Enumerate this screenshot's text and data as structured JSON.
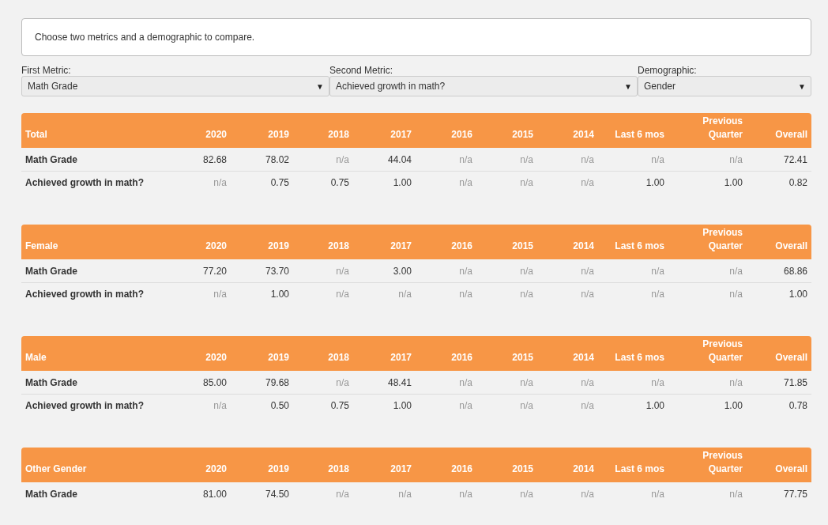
{
  "instructions": "Choose two metrics and a demographic to compare.",
  "selectors": [
    {
      "label": "First Metric:",
      "value": "Math Grade",
      "arrow": "▼"
    },
    {
      "label": "Second Metric:",
      "value": "Achieved growth in math?",
      "arrow": "▼"
    },
    {
      "label": "Demographic:",
      "value": "Gender",
      "arrow": "▼"
    }
  ],
  "tables": [
    {
      "group": "Total",
      "columns": [
        "2020",
        "2019",
        "2018",
        "2017",
        "2016",
        "2015",
        "2014",
        "Last 6 mos",
        "Previous Quarter",
        "Overall"
      ],
      "rows": [
        {
          "metric": "Math Grade",
          "cells": [
            {
              "text": "82.68",
              "missing": false
            },
            {
              "text": "78.02",
              "missing": false
            },
            {
              "text": "n/a",
              "missing": true
            },
            {
              "text": "44.04",
              "missing": false
            },
            {
              "text": "n/a",
              "missing": true
            },
            {
              "text": "n/a",
              "missing": true
            },
            {
              "text": "n/a",
              "missing": true
            },
            {
              "text": "n/a",
              "missing": true
            },
            {
              "text": "n/a",
              "missing": true
            },
            {
              "text": "72.41",
              "missing": false
            }
          ]
        },
        {
          "metric": "Achieved growth in math?",
          "cells": [
            {
              "text": "n/a",
              "missing": true
            },
            {
              "text": "0.75",
              "missing": false
            },
            {
              "text": "0.75",
              "missing": false
            },
            {
              "text": "1.00",
              "missing": false
            },
            {
              "text": "n/a",
              "missing": true
            },
            {
              "text": "n/a",
              "missing": true
            },
            {
              "text": "n/a",
              "missing": true
            },
            {
              "text": "1.00",
              "missing": false
            },
            {
              "text": "1.00",
              "missing": false
            },
            {
              "text": "0.82",
              "missing": false
            }
          ]
        }
      ]
    },
    {
      "group": "Female",
      "columns": [
        "2020",
        "2019",
        "2018",
        "2017",
        "2016",
        "2015",
        "2014",
        "Last 6 mos",
        "Previous Quarter",
        "Overall"
      ],
      "rows": [
        {
          "metric": "Math Grade",
          "cells": [
            {
              "text": "77.20",
              "missing": false
            },
            {
              "text": "73.70",
              "missing": false
            },
            {
              "text": "n/a",
              "missing": true
            },
            {
              "text": "3.00",
              "missing": false
            },
            {
              "text": "n/a",
              "missing": true
            },
            {
              "text": "n/a",
              "missing": true
            },
            {
              "text": "n/a",
              "missing": true
            },
            {
              "text": "n/a",
              "missing": true
            },
            {
              "text": "n/a",
              "missing": true
            },
            {
              "text": "68.86",
              "missing": false
            }
          ]
        },
        {
          "metric": "Achieved growth in math?",
          "cells": [
            {
              "text": "n/a",
              "missing": true
            },
            {
              "text": "1.00",
              "missing": false
            },
            {
              "text": "n/a",
              "missing": true
            },
            {
              "text": "n/a",
              "missing": true
            },
            {
              "text": "n/a",
              "missing": true
            },
            {
              "text": "n/a",
              "missing": true
            },
            {
              "text": "n/a",
              "missing": true
            },
            {
              "text": "n/a",
              "missing": true
            },
            {
              "text": "n/a",
              "missing": true
            },
            {
              "text": "1.00",
              "missing": false
            }
          ]
        }
      ]
    },
    {
      "group": "Male",
      "columns": [
        "2020",
        "2019",
        "2018",
        "2017",
        "2016",
        "2015",
        "2014",
        "Last 6 mos",
        "Previous Quarter",
        "Overall"
      ],
      "rows": [
        {
          "metric": "Math Grade",
          "cells": [
            {
              "text": "85.00",
              "missing": false
            },
            {
              "text": "79.68",
              "missing": false
            },
            {
              "text": "n/a",
              "missing": true
            },
            {
              "text": "48.41",
              "missing": false
            },
            {
              "text": "n/a",
              "missing": true
            },
            {
              "text": "n/a",
              "missing": true
            },
            {
              "text": "n/a",
              "missing": true
            },
            {
              "text": "n/a",
              "missing": true
            },
            {
              "text": "n/a",
              "missing": true
            },
            {
              "text": "71.85",
              "missing": false
            }
          ]
        },
        {
          "metric": "Achieved growth in math?",
          "cells": [
            {
              "text": "n/a",
              "missing": true
            },
            {
              "text": "0.50",
              "missing": false
            },
            {
              "text": "0.75",
              "missing": false
            },
            {
              "text": "1.00",
              "missing": false
            },
            {
              "text": "n/a",
              "missing": true
            },
            {
              "text": "n/a",
              "missing": true
            },
            {
              "text": "n/a",
              "missing": true
            },
            {
              "text": "1.00",
              "missing": false
            },
            {
              "text": "1.00",
              "missing": false
            },
            {
              "text": "0.78",
              "missing": false
            }
          ]
        }
      ]
    },
    {
      "group": "Other Gender",
      "columns": [
        "2020",
        "2019",
        "2018",
        "2017",
        "2016",
        "2015",
        "2014",
        "Last 6 mos",
        "Previous Quarter",
        "Overall"
      ],
      "rows": [
        {
          "metric": "Math Grade",
          "cells": [
            {
              "text": "81.00",
              "missing": false
            },
            {
              "text": "74.50",
              "missing": false
            },
            {
              "text": "n/a",
              "missing": true
            },
            {
              "text": "n/a",
              "missing": true
            },
            {
              "text": "n/a",
              "missing": true
            },
            {
              "text": "n/a",
              "missing": true
            },
            {
              "text": "n/a",
              "missing": true
            },
            {
              "text": "n/a",
              "missing": true
            },
            {
              "text": "n/a",
              "missing": true
            },
            {
              "text": "77.75",
              "missing": false
            }
          ]
        }
      ]
    }
  ]
}
